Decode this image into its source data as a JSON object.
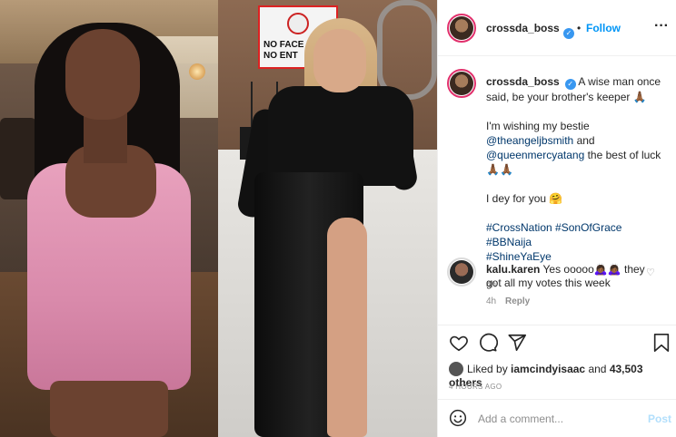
{
  "post": {
    "author": "crossda_boss",
    "follow_separator": "•",
    "follow_label": "Follow",
    "more_label": "···"
  },
  "sign": {
    "line1": "NO FACE M",
    "line2": "NO ENT"
  },
  "caption": {
    "author": "crossda_boss",
    "line1": "A wise man once said, be your brother's keeper 🙏🏾",
    "para2_pre": "I'm wishing my bestie",
    "mention1": "@theangeljbsmith",
    "para2_mid": " and",
    "mention2": "@queenmercyatang",
    "para2_post": " the best of luck 🙏🏾🙏🏾",
    "para3": "I dey for you 🤗",
    "tags": [
      "#CrossNation",
      "#SonOfGrace",
      "#BBNaija",
      "#ShineYaEye"
    ],
    "time": "4h"
  },
  "comment": {
    "author": "kalu.karen",
    "text": "Yes ooooo🙇🏾‍♀️🙇🏾‍♀️ they got all my votes this week",
    "time": "4h",
    "reply_label": "Reply"
  },
  "actions": {
    "like_icon": "heart-icon",
    "comment_icon": "comment-icon",
    "share_icon": "share-icon",
    "save_icon": "bookmark-icon"
  },
  "likes": {
    "prefix": "Liked by",
    "user": "iamcindyisaac",
    "joiner": "and",
    "count": "43,503 others"
  },
  "posted": "4 HOURS AGO",
  "add_comment": {
    "placeholder": "Add a comment...",
    "post_label": "Post"
  },
  "colors": {
    "accent": "#0095f6",
    "link": "#00376b",
    "muted": "#8e8e8e"
  }
}
